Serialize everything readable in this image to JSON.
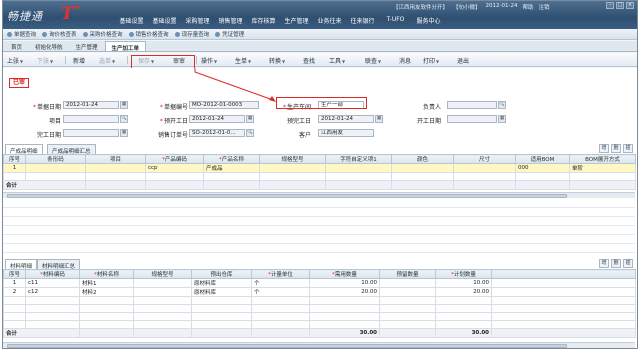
{
  "app": {
    "logo_text": "畅捷通",
    "logo_t": "T",
    "logo_plus": "+"
  },
  "topinfo": {
    "company": "【江西用友软件分开】",
    "user": "【句小微】",
    "date": "2012-01-24",
    "help": "帮助",
    "logout": "注销"
  },
  "main_menu": [
    "基础设置",
    "基础设置",
    "采购管理",
    "销售管理",
    "库存核算",
    "生产管理",
    "业务往来",
    "往来银行",
    "T-UFO",
    "服务中心"
  ],
  "quick_links": [
    "单据查询",
    "询价核查表",
    "采购价格查询",
    "销售价格查询",
    "现存量查询",
    "凭证管理"
  ],
  "page_tabs": [
    {
      "label": "首页"
    },
    {
      "label": "初始化导航"
    },
    {
      "label": "生产管理"
    },
    {
      "label": "生产加工单"
    }
  ],
  "toolbar": {
    "up": "上张",
    "down": "下张",
    "new": "新增",
    "copy": "选单",
    "save": "保存",
    "audit": "审审",
    "operate": "操作",
    "produce": "生单",
    "convert": "转换",
    "query": "查找",
    "tools": "工具",
    "link": "联查",
    "message": "消息",
    "print": "打印",
    "exit": "退出"
  },
  "doc": {
    "title": "已审",
    "fields": {
      "doc_date_label": "单据日期",
      "doc_date": "2012-01-24",
      "doc_no_label": "单据编号",
      "doc_no": "MO-2012-01-0003",
      "workshop_label": "生产车间",
      "workshop": "生产一部",
      "owner_label": "负责人",
      "owner": "",
      "project_label": "项目",
      "project": "",
      "plan_start_label": "预开工日",
      "plan_start": "2012-01-24",
      "plan_finish_label": "预完工日",
      "plan_finish": "2012-01-24",
      "start_label": "开工日期",
      "start": "",
      "finish_label": "完工日期",
      "finish": "",
      "sales_order_label": "销售订单号",
      "sales_order": "SO-2012-01-0...",
      "customer_label": "客户",
      "customer": "江西用友"
    }
  },
  "product_grid": {
    "tabs": [
      "产成品明细",
      "产成品明细汇总"
    ],
    "buttons": [
      "增",
      "删",
      "插"
    ],
    "headers": [
      "序号",
      "条形码",
      "项目",
      "产品编码",
      "产品名称",
      "规格型号",
      "字符自定义项1",
      "颜色",
      "尺寸",
      "适用BOM",
      "BOM展开方式"
    ],
    "rows": [
      [
        "1",
        "",
        "",
        "ccp",
        "产成品",
        "",
        "",
        "",
        "",
        "000",
        "单阶"
      ]
    ],
    "total_label": "合计"
  },
  "material_grid": {
    "tabs": [
      "材料明细",
      "材料明细汇总"
    ],
    "buttons": [
      "增",
      "删",
      "插"
    ],
    "headers": [
      "序号",
      "材料编码",
      "材料名称",
      "规格型号",
      "预出仓库",
      "计量单位",
      "需用数量",
      "预留数量",
      "计划数量"
    ],
    "required": [
      false,
      true,
      true,
      false,
      false,
      true,
      true,
      false,
      true
    ],
    "rows": [
      [
        "1",
        "c11",
        "材料1",
        "",
        "原材料库",
        "个",
        "10.00",
        "",
        "10.00"
      ],
      [
        "2",
        "c12",
        "材料2",
        "",
        "原材料库",
        "个",
        "20.00",
        "",
        "20.00"
      ]
    ],
    "total_label": "合计",
    "total_required": "30.00",
    "total_planned": "30.00"
  },
  "colors": {
    "header_bg": "#2f4f70",
    "highlight_red": "#e02828",
    "selected_row": "#fff8c4"
  }
}
